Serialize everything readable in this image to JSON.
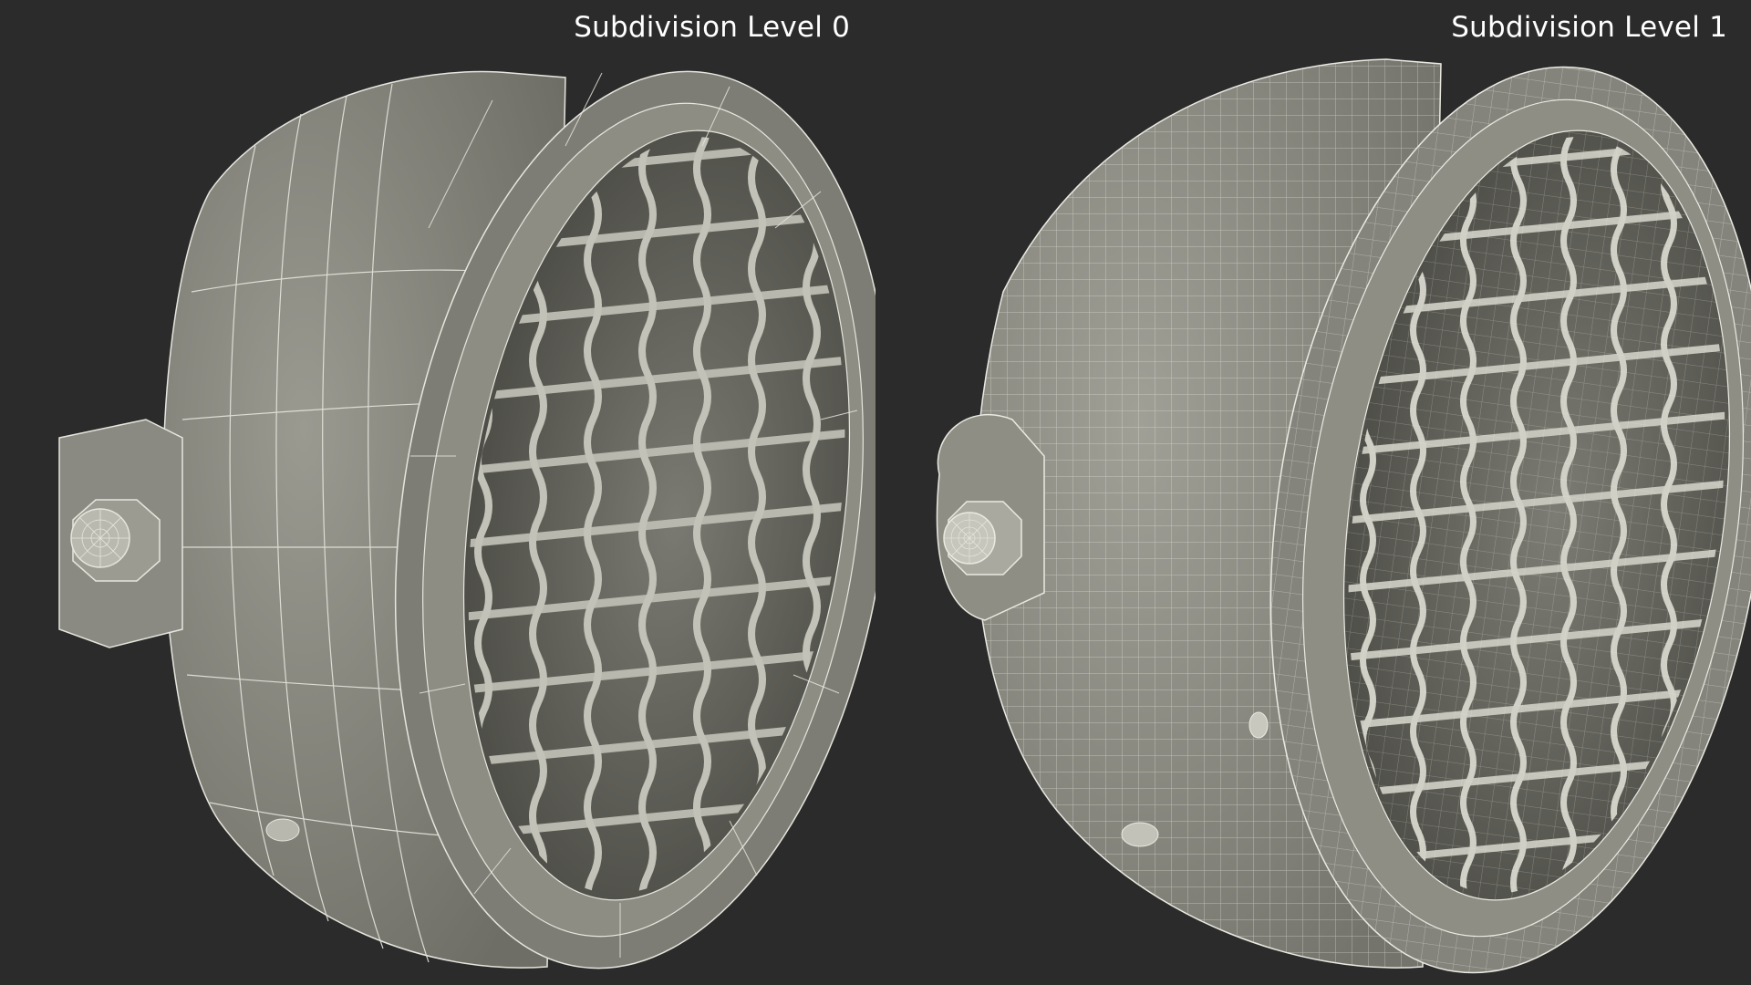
{
  "panels": [
    {
      "label": "Subdivision Level 0",
      "subdivision_level": 0
    },
    {
      "label": "Subdivision Level 1",
      "subdivision_level": 1
    }
  ],
  "colors": {
    "background": "#2b2b2b",
    "surface": "#8e8e85",
    "surface_dark": "#5f5f58",
    "wire": "#e9e9e1",
    "label": "#ffffff"
  }
}
